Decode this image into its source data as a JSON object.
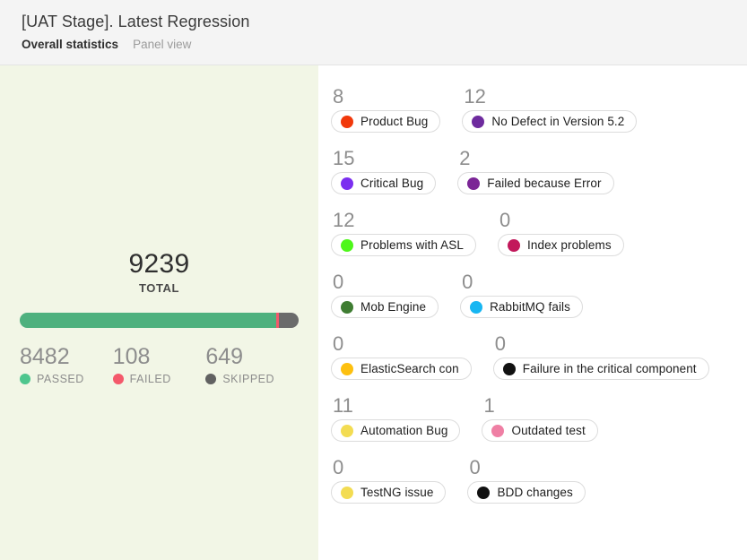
{
  "header": {
    "title": "[UAT Stage]. Latest Regression",
    "tabs": [
      {
        "label": "Overall statistics",
        "active": true
      },
      {
        "label": "Panel view",
        "active": false
      }
    ]
  },
  "summary": {
    "total_value": "9239",
    "total_label": "TOTAL",
    "bar": [
      {
        "name": "passed",
        "value": 8482,
        "color": "#4eb17e"
      },
      {
        "name": "failed",
        "value": 108,
        "color": "#f4596b"
      },
      {
        "name": "skipped",
        "value": 649,
        "color": "#6b6b6b"
      }
    ],
    "stats": [
      {
        "value": "8482",
        "label": "PASSED",
        "color": "#4ec68e"
      },
      {
        "value": "108",
        "label": "FAILED",
        "color": "#f4596b"
      },
      {
        "value": "649",
        "label": "SKIPPED",
        "color": "#616161"
      }
    ]
  },
  "defects": [
    {
      "count": "8",
      "label": "Product Bug",
      "color": "#f1380b"
    },
    {
      "count": "12",
      "label": "No Defect in Version 5.2",
      "color": "#6e2b9e"
    },
    {
      "count": "15",
      "label": "Critical Bug",
      "color": "#7b2ef0"
    },
    {
      "count": "2",
      "label": "Failed because Error",
      "color": "#7b2596"
    },
    {
      "count": "12",
      "label": "Problems with ASL",
      "color": "#4ef71a"
    },
    {
      "count": "0",
      "label": "Index problems",
      "color": "#c2185b"
    },
    {
      "count": "0",
      "label": "Mob Engine",
      "color": "#3f7d32"
    },
    {
      "count": "0",
      "label": "RabbitMQ fails",
      "color": "#17b6f2"
    },
    {
      "count": "0",
      "label": "ElasticSearch con",
      "color": "#fdc00f"
    },
    {
      "count": "0",
      "label": "Failure in the critical component",
      "color": "#111111"
    },
    {
      "count": "11",
      "label": "Automation Bug",
      "color": "#f3dc52"
    },
    {
      "count": "1",
      "label": "Outdated test",
      "color": "#ef7fa4"
    },
    {
      "count": "0",
      "label": "TestNG issue",
      "color": "#f3dc52"
    },
    {
      "count": "0",
      "label": "BDD changes",
      "color": "#111111"
    }
  ]
}
